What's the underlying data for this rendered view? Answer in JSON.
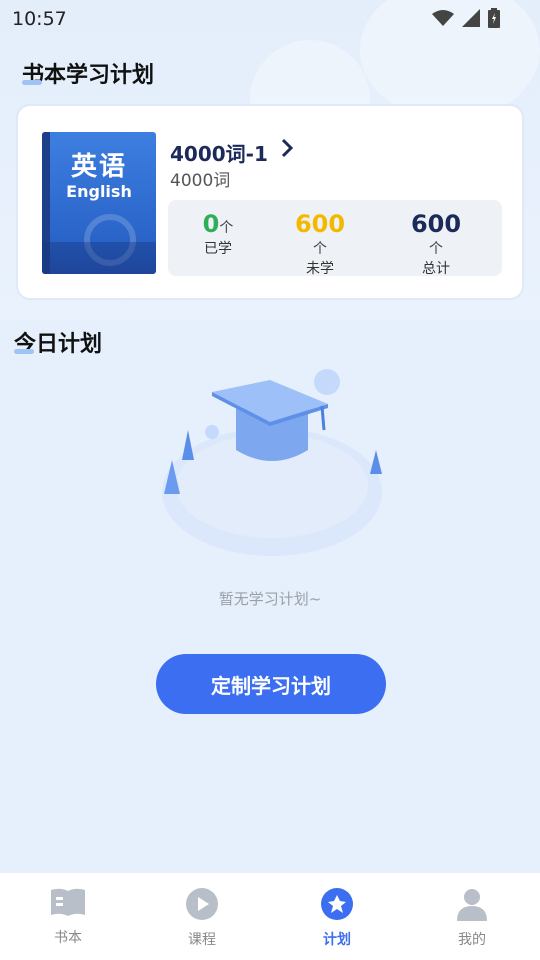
{
  "status_bar": {
    "time": "10:57"
  },
  "book_section": {
    "title": "书本学习计划",
    "book": {
      "cover_title_cn": "英语",
      "cover_title_en": "English",
      "name": "4000词-1",
      "subtitle": "4000词"
    },
    "stats": [
      {
        "value": "0",
        "unit": "个",
        "label": "已学",
        "color": "#2fae5a"
      },
      {
        "value": "600",
        "unit": "个",
        "label": "未学",
        "color": "#f5b800"
      },
      {
        "value": "600",
        "unit": "个",
        "label": "总计",
        "color": "#1c2a5a"
      }
    ]
  },
  "today_section": {
    "title": "今日计划",
    "empty_text": "暂无学习计划~",
    "cta_label": "定制学习计划"
  },
  "tabbar": {
    "items": [
      {
        "label": "书本",
        "icon": "book-icon",
        "active": false
      },
      {
        "label": "课程",
        "icon": "play-icon",
        "active": false
      },
      {
        "label": "计划",
        "icon": "plan-icon",
        "active": true
      },
      {
        "label": "我的",
        "icon": "user-icon",
        "active": false
      }
    ]
  },
  "colors": {
    "accent": "#3b6ef0",
    "background": "#e6f0fc"
  }
}
